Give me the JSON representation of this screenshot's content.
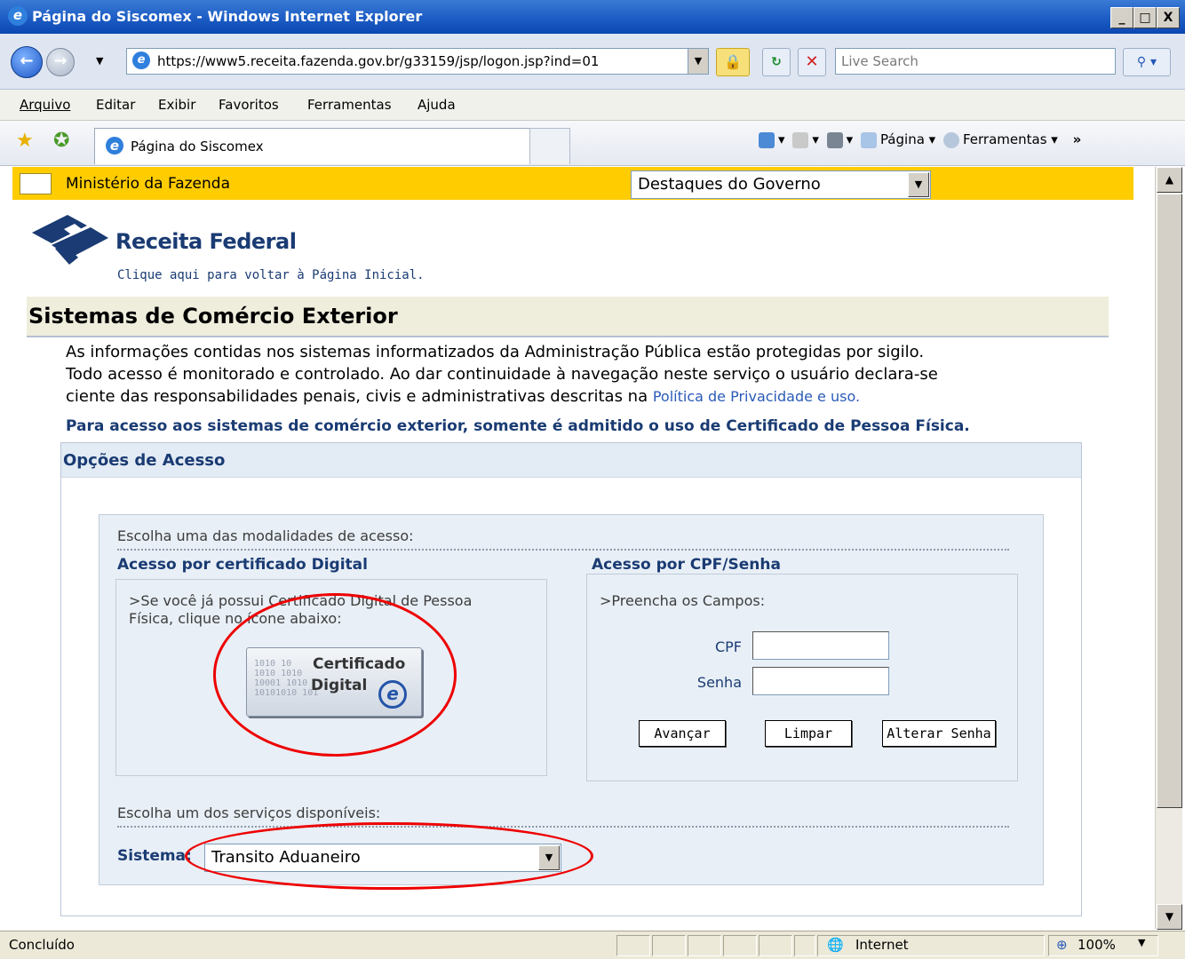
{
  "window": {
    "title": "Página do Siscomex - Windows Internet Explorer",
    "controls": [
      "_",
      "□",
      "X"
    ]
  },
  "address": {
    "url": "https://www5.receita.fazenda.gov.br/g33159/jsp/logon.jsp?ind=01",
    "search_placeholder": "Live Search"
  },
  "menu": [
    "Arquivo",
    "Editar",
    "Exibir",
    "Favoritos",
    "Ferramentas",
    "Ajuda"
  ],
  "tab": {
    "label": "Página do Siscomex"
  },
  "toolbar": {
    "page_label": "Página",
    "tools_label": "Ferramentas"
  },
  "gov_bar": {
    "label": "Ministério da Fazenda",
    "select_value": "Destaques do Governo"
  },
  "header": {
    "brand": "Receita Federal",
    "back_link": "Clique aqui para voltar à Página Inicial."
  },
  "section": {
    "title": "Sistemas de Comércio Exterior",
    "para_line1": "As informações contidas nos sistemas informatizados da Administração Pública estão protegidas por sigilo.",
    "para_line2": "Todo acesso é monitorado e controlado. Ao dar continuidade à navegação neste serviço o usuário declara-se",
    "para_line3": "ciente das responsabilidades penais, civis e administrativas descritas na",
    "privacy_link": "Política de Privacidade e uso.",
    "notice": "Para acesso aos sistemas de comércio exterior, somente é admitido o uso de Certificado de Pessoa Física."
  },
  "access": {
    "heading": "Opções de Acesso",
    "choose_mode": "Escolha uma das modalidades de acesso:",
    "cert_heading": "Acesso por certificado Digital",
    "cert_text_1": ">Se você já possui Certificado Digital de Pessoa",
    "cert_text_2": "Física, clique no ícone abaixo:",
    "cert_button_1": "Certificado",
    "cert_button_2": "Digital",
    "cert_binary": "1010 10\n1010 1010\n10001 1010\n10101010 101",
    "cpf_heading": "Acesso por CPF/Senha",
    "cpf_text": ">Preencha os Campos:",
    "cpf_label": "CPF",
    "senha_label": "Senha",
    "cpf_value": "",
    "senha_value": "",
    "btn_advance": "Avançar",
    "btn_clear": "Limpar",
    "btn_change_password": "Alterar Senha",
    "choose_service": "Escolha um dos serviços disponíveis:",
    "system_label": "Sistema:",
    "system_value": "Transito Aduaneiro"
  },
  "status": {
    "text": "Concluído",
    "zone": "Internet",
    "zoom": "100%"
  },
  "colors": {
    "gov_bar": "#ffcc00",
    "brand_blue": "#1a3b73",
    "highlight_red": "#e00000"
  }
}
